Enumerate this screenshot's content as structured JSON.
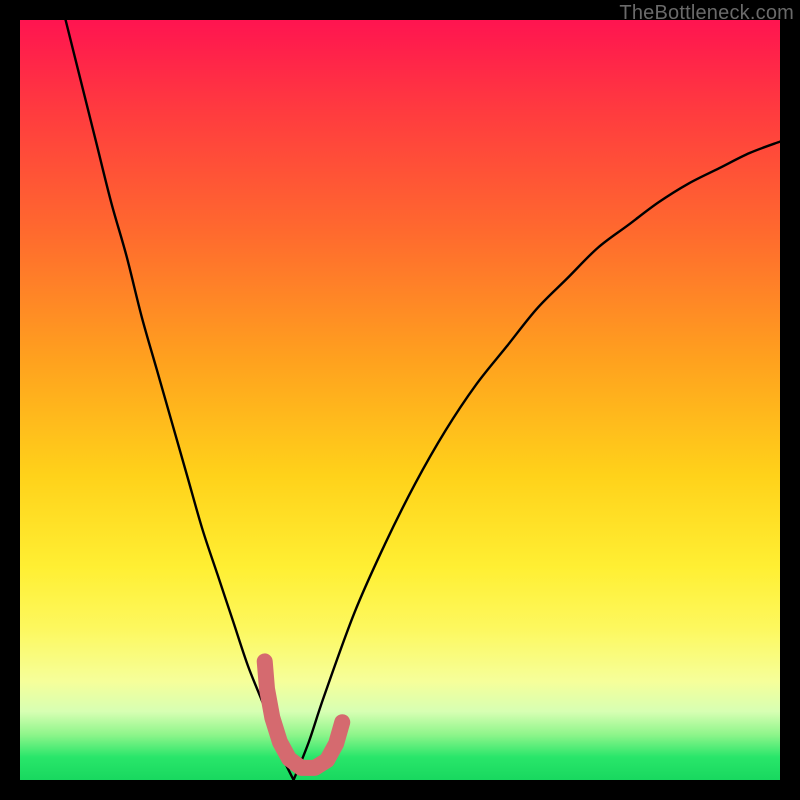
{
  "watermark": "TheBottleneck.com",
  "colors": {
    "curve": "#000000",
    "doodle": "#d56a6f",
    "background_top": "#ff1450",
    "background_bottom": "#18d85f"
  },
  "chart_data": {
    "type": "line",
    "title": "",
    "xlabel": "",
    "ylabel": "",
    "xlim": [
      0,
      100
    ],
    "ylim": [
      0,
      100
    ],
    "series": [
      {
        "name": "left-branch",
        "x": [
          6,
          8,
          10,
          12,
          14,
          16,
          18,
          20,
          22,
          24,
          26,
          28,
          30,
          32,
          33,
          34,
          35,
          36
        ],
        "y": [
          100,
          92,
          84,
          76,
          69,
          61,
          54,
          47,
          40,
          33,
          27,
          21,
          15,
          10,
          7,
          4,
          2,
          0
        ]
      },
      {
        "name": "right-branch",
        "x": [
          36,
          38,
          40,
          44,
          48,
          52,
          56,
          60,
          64,
          68,
          72,
          76,
          80,
          84,
          88,
          92,
          96,
          100
        ],
        "y": [
          0,
          5,
          11,
          22,
          31,
          39,
          46,
          52,
          57,
          62,
          66,
          70,
          73,
          76,
          78.5,
          80.5,
          82.5,
          84
        ]
      }
    ],
    "annotations": [
      {
        "name": "doodle",
        "type": "freehand",
        "color": "#d56a6f",
        "points_plot_pct": [
          [
            32.2,
            15.6
          ],
          [
            32.5,
            12.0
          ],
          [
            33.2,
            8.2
          ],
          [
            34.2,
            5.0
          ],
          [
            35.4,
            2.8
          ],
          [
            37.0,
            1.6
          ],
          [
            38.8,
            1.6
          ],
          [
            40.4,
            2.6
          ],
          [
            41.6,
            4.8
          ],
          [
            42.4,
            7.6
          ]
        ]
      }
    ]
  }
}
